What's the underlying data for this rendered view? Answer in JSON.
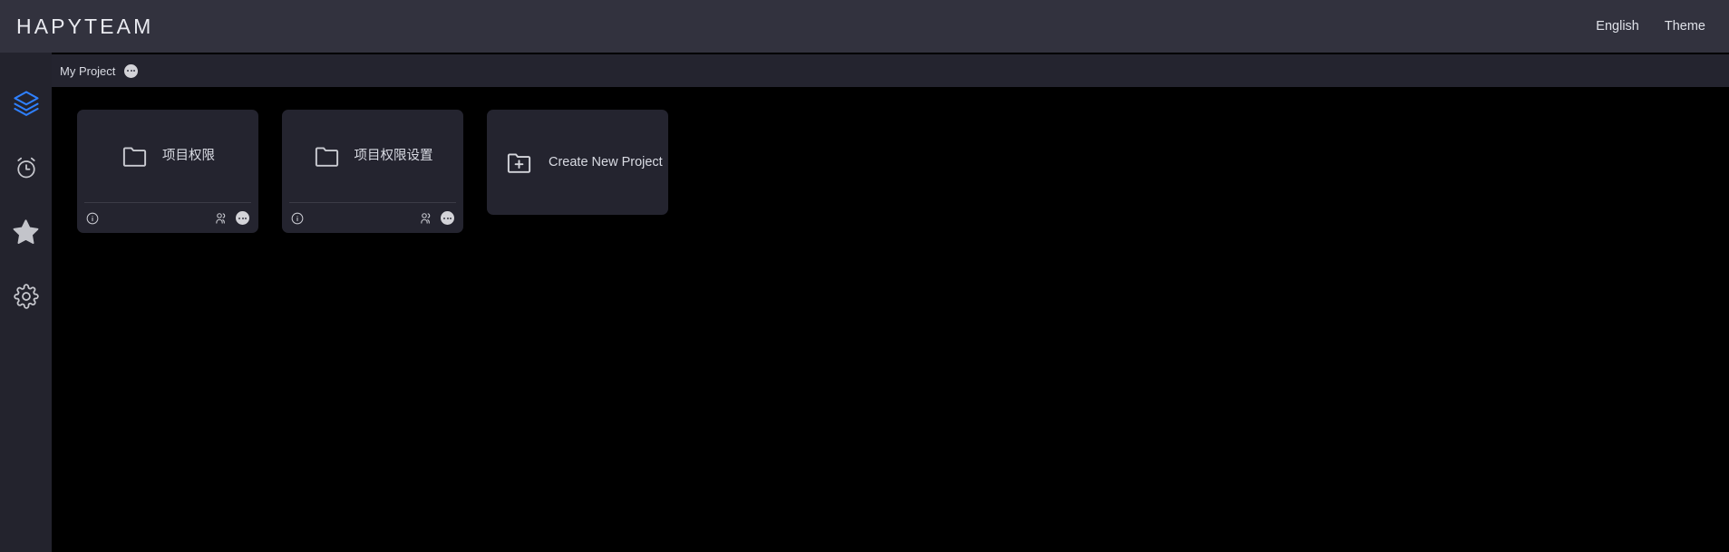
{
  "header": {
    "brand": "HAPYTEAM",
    "links": [
      {
        "label": "English",
        "name": "language-link"
      },
      {
        "label": "Theme",
        "name": "theme-link"
      }
    ]
  },
  "sidebar": {
    "items": [
      {
        "icon": "layers-icon",
        "name": "sidebar-item-projects",
        "active": true
      },
      {
        "icon": "alarm-clock-icon",
        "name": "sidebar-item-recent",
        "active": false
      },
      {
        "icon": "star-icon",
        "name": "sidebar-item-favorites",
        "active": false
      },
      {
        "icon": "gear-icon",
        "name": "sidebar-item-settings",
        "active": false
      }
    ],
    "accent_color": "#2f80ff",
    "icon_color": "#c8c9cf",
    "background": "#23232d"
  },
  "project_bar": {
    "tab_label": "My Project",
    "more_icon": "ellipsis-icon",
    "background": "#24242f"
  },
  "main": {
    "background": "#000000",
    "cards": [
      {
        "title": "项目权限",
        "icon": "folder-icon",
        "type": "project",
        "footer": {
          "info_icon": "info-circle-icon",
          "members_icon": "users-icon",
          "more_icon": "ellipsis-icon"
        }
      },
      {
        "title": "项目权限设置",
        "icon": "folder-icon",
        "type": "project",
        "footer": {
          "info_icon": "info-circle-icon",
          "members_icon": "users-icon",
          "more_icon": "ellipsis-icon"
        }
      },
      {
        "title": "Create New Project",
        "icon": "folder-plus-icon",
        "type": "create"
      }
    ]
  },
  "colors": {
    "header_bg": "#32323e",
    "card_bg": "#24242f",
    "text_primary": "#d9dbe3",
    "accent_blue": "#2f80ff",
    "divider": "#3b3b47"
  }
}
